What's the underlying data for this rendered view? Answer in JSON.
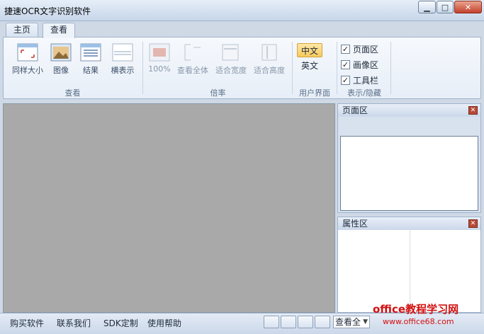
{
  "window": {
    "title": "捷速OCR文字识别软件"
  },
  "tabs": [
    {
      "label": "主页"
    },
    {
      "label": "查看"
    }
  ],
  "ribbon": {
    "view_group": {
      "label": "查看",
      "buttons": [
        {
          "label": "同样大小"
        },
        {
          "label": "图像"
        },
        {
          "label": "结果"
        },
        {
          "label": "横表示"
        }
      ]
    },
    "zoom_group": {
      "label": "倍率",
      "buttons": [
        {
          "label": "100%"
        },
        {
          "label": "查看全体"
        },
        {
          "label": "适合宽度"
        },
        {
          "label": "适合高度"
        }
      ]
    },
    "ui_group": {
      "label": "用户界面",
      "options": [
        {
          "label": "中文"
        },
        {
          "label": "英文"
        }
      ]
    },
    "show_group": {
      "label": "表示/隐藏",
      "items": [
        {
          "label": "页面区",
          "checked": true
        },
        {
          "label": "画像区",
          "checked": true
        },
        {
          "label": "工具栏",
          "checked": true
        }
      ]
    }
  },
  "panels": {
    "page_title": "页面区",
    "prop_title": "属性区"
  },
  "statusbar": {
    "links": [
      {
        "label": "购买软件"
      },
      {
        "label": "联系我们"
      },
      {
        "label": "SDK定制"
      },
      {
        "label": "使用帮助"
      }
    ],
    "zoom_value": "查看全"
  },
  "watermark": {
    "text": "office教程学习网",
    "url": "www.office68.com"
  },
  "colors": {
    "accent": "#f7c95d",
    "canvas": "#a9a9a9",
    "ribbon": "#e7eef7"
  }
}
